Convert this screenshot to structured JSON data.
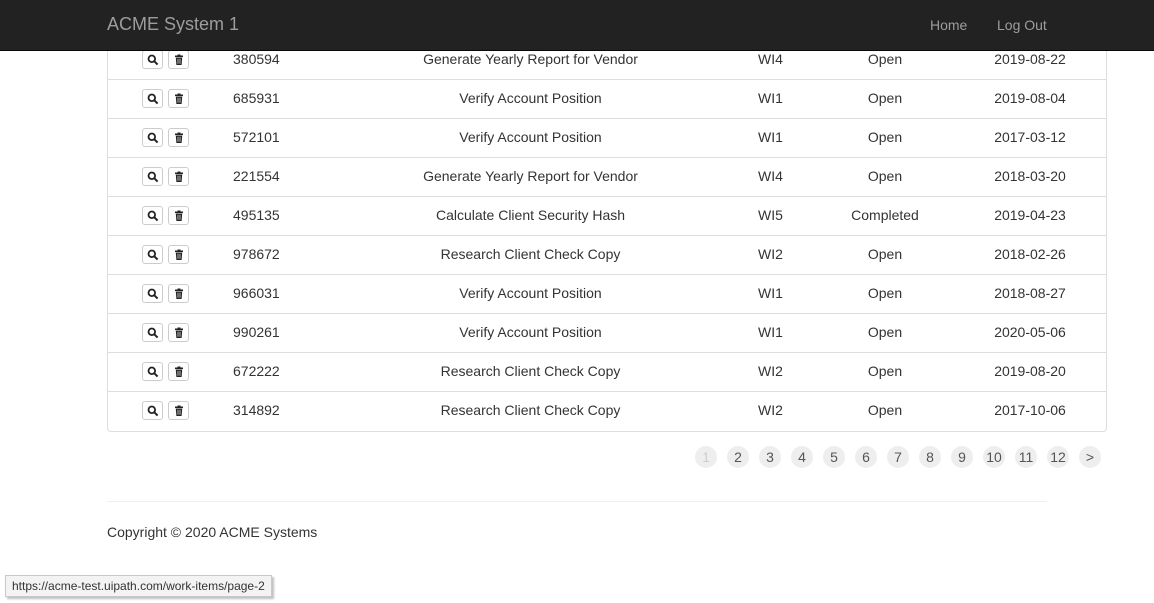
{
  "navbar": {
    "brand": "ACME System 1",
    "links": [
      "Home",
      "Log Out"
    ]
  },
  "table": {
    "rows": [
      {
        "id": "380594",
        "description": "Generate Yearly Report for Vendor",
        "type": "WI4",
        "status": "Open",
        "date": "2019-08-22"
      },
      {
        "id": "685931",
        "description": "Verify Account Position",
        "type": "WI1",
        "status": "Open",
        "date": "2019-08-04"
      },
      {
        "id": "572101",
        "description": "Verify Account Position",
        "type": "WI1",
        "status": "Open",
        "date": "2017-03-12"
      },
      {
        "id": "221554",
        "description": "Generate Yearly Report for Vendor",
        "type": "WI4",
        "status": "Open",
        "date": "2018-03-20"
      },
      {
        "id": "495135",
        "description": "Calculate Client Security Hash",
        "type": "WI5",
        "status": "Completed",
        "date": "2019-04-23"
      },
      {
        "id": "978672",
        "description": "Research Client Check Copy",
        "type": "WI2",
        "status": "Open",
        "date": "2018-02-26"
      },
      {
        "id": "966031",
        "description": "Verify Account Position",
        "type": "WI1",
        "status": "Open",
        "date": "2018-08-27"
      },
      {
        "id": "990261",
        "description": "Verify Account Position",
        "type": "WI1",
        "status": "Open",
        "date": "2020-05-06"
      },
      {
        "id": "672222",
        "description": "Research Client Check Copy",
        "type": "WI2",
        "status": "Open",
        "date": "2019-08-20"
      },
      {
        "id": "314892",
        "description": "Research Client Check Copy",
        "type": "WI2",
        "status": "Open",
        "date": "2017-10-06"
      }
    ],
    "row_icons": [
      "search-icon",
      "trash-icon"
    ]
  },
  "pagination": {
    "pages": [
      "1",
      "2",
      "3",
      "4",
      "5",
      "6",
      "7",
      "8",
      "9",
      "10",
      "11",
      "12",
      ">"
    ],
    "active": "1"
  },
  "footer": {
    "copyright": "Copyright © 2020 ACME Systems"
  },
  "statusbar": {
    "url": "https://acme-test.uipath.com/work-items/page-2"
  }
}
